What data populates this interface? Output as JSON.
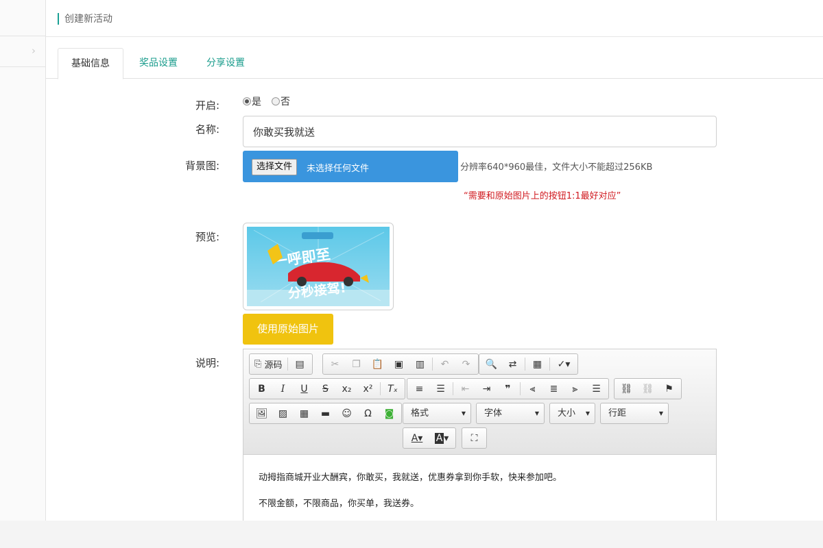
{
  "header": {
    "title": "创建新活动"
  },
  "tabs": [
    {
      "label": "基础信息",
      "active": true
    },
    {
      "label": "奖品设置",
      "active": false
    },
    {
      "label": "分享设置",
      "active": false
    }
  ],
  "form": {
    "enable": {
      "label": "开启:",
      "options": [
        "是",
        "否"
      ],
      "selected": "是"
    },
    "name": {
      "label": "名称:",
      "value": "你敢买我就送"
    },
    "background": {
      "label": "背景图:",
      "choose_button": "选择文件",
      "no_file_text": "未选择任何文件",
      "hint": "分辨率640*960最佳，文件大小不能超过256KB",
      "red_note": "“需要和原始图片上的按钮1:1最好对应”"
    },
    "preview": {
      "label": "预览:",
      "use_original_button": "使用原始图片"
    },
    "description": {
      "label": "说明:",
      "toolbar": {
        "source_label": "源码",
        "format_combo": "格式",
        "font_combo": "字体",
        "size_combo": "大小",
        "lineheight_combo": "行距"
      },
      "content": [
        "动拇指商城开业大酬宾，你敢买，我就送，优惠券拿到你手软，快来参加吧。",
        "不限金额，不限商品，你买单，我送券。"
      ]
    }
  },
  "colors": {
    "accent": "#1aa094",
    "file_bg": "#3a95de",
    "orig_btn": "#f0c30f",
    "red_note": "#d0191f"
  }
}
